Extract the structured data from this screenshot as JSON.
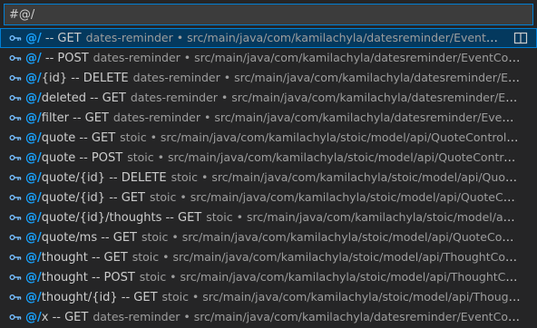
{
  "search": {
    "value": "#@/"
  },
  "icons": {
    "symbol": "symbol-key-icon",
    "split": "split-editor-icon"
  },
  "colors": {
    "highlight": "#18a3ff",
    "selection": "#04395e",
    "focus_border": "#007fd4"
  },
  "items": [
    {
      "match": "@/",
      "rest": " -- GET",
      "project": "dates-reminder",
      "path": "src/main/java/com/kamilachyla/datesreminder/EventController.java"
    },
    {
      "match": "@/",
      "rest": " -- POST",
      "project": "dates-reminder",
      "path": "src/main/java/com/kamilachyla/datesreminder/EventController.java"
    },
    {
      "match": "@/",
      "rest": "{id} -- DELETE",
      "project": "dates-reminder",
      "path": "src/main/java/com/kamilachyla/datesreminder/EventController.java"
    },
    {
      "match": "@/",
      "rest": "deleted -- GET",
      "project": "dates-reminder",
      "path": "src/main/java/com/kamilachyla/datesreminder/EventController.java"
    },
    {
      "match": "@/",
      "rest": "filter -- GET",
      "project": "dates-reminder",
      "path": "src/main/java/com/kamilachyla/datesreminder/EventController.java"
    },
    {
      "match": "@/",
      "rest": "quote -- GET",
      "project": "stoic",
      "path": "src/main/java/com/kamilachyla/stoic/model/api/QuoteController.java"
    },
    {
      "match": "@/",
      "rest": "quote -- POST",
      "project": "stoic",
      "path": "src/main/java/com/kamilachyla/stoic/model/api/QuoteController.java"
    },
    {
      "match": "@/",
      "rest": "quote/{id} -- DELETE",
      "project": "stoic",
      "path": "src/main/java/com/kamilachyla/stoic/model/api/QuoteController.java"
    },
    {
      "match": "@/",
      "rest": "quote/{id} -- GET",
      "project": "stoic",
      "path": "src/main/java/com/kamilachyla/stoic/model/api/QuoteController.java"
    },
    {
      "match": "@/",
      "rest": "quote/{id}/thoughts -- GET",
      "project": "stoic",
      "path": "src/main/java/com/kamilachyla/stoic/model/api/QuoteController.java"
    },
    {
      "match": "@/",
      "rest": "quote/ms -- GET",
      "project": "stoic",
      "path": "src/main/java/com/kamilachyla/stoic/model/api/QuoteController.java"
    },
    {
      "match": "@/",
      "rest": "thought -- GET",
      "project": "stoic",
      "path": "src/main/java/com/kamilachyla/stoic/model/api/ThoughtController.java"
    },
    {
      "match": "@/",
      "rest": "thought -- POST",
      "project": "stoic",
      "path": "src/main/java/com/kamilachyla/stoic/model/api/ThoughtController.java"
    },
    {
      "match": "@/",
      "rest": "thought/{id} -- GET",
      "project": "stoic",
      "path": "src/main/java/com/kamilachyla/stoic/model/api/ThoughtController.java"
    },
    {
      "match": "@/",
      "rest": "x -- GET",
      "project": "dates-reminder",
      "path": "src/main/java/com/kamilachyla/datesreminder/EventController.java"
    }
  ]
}
